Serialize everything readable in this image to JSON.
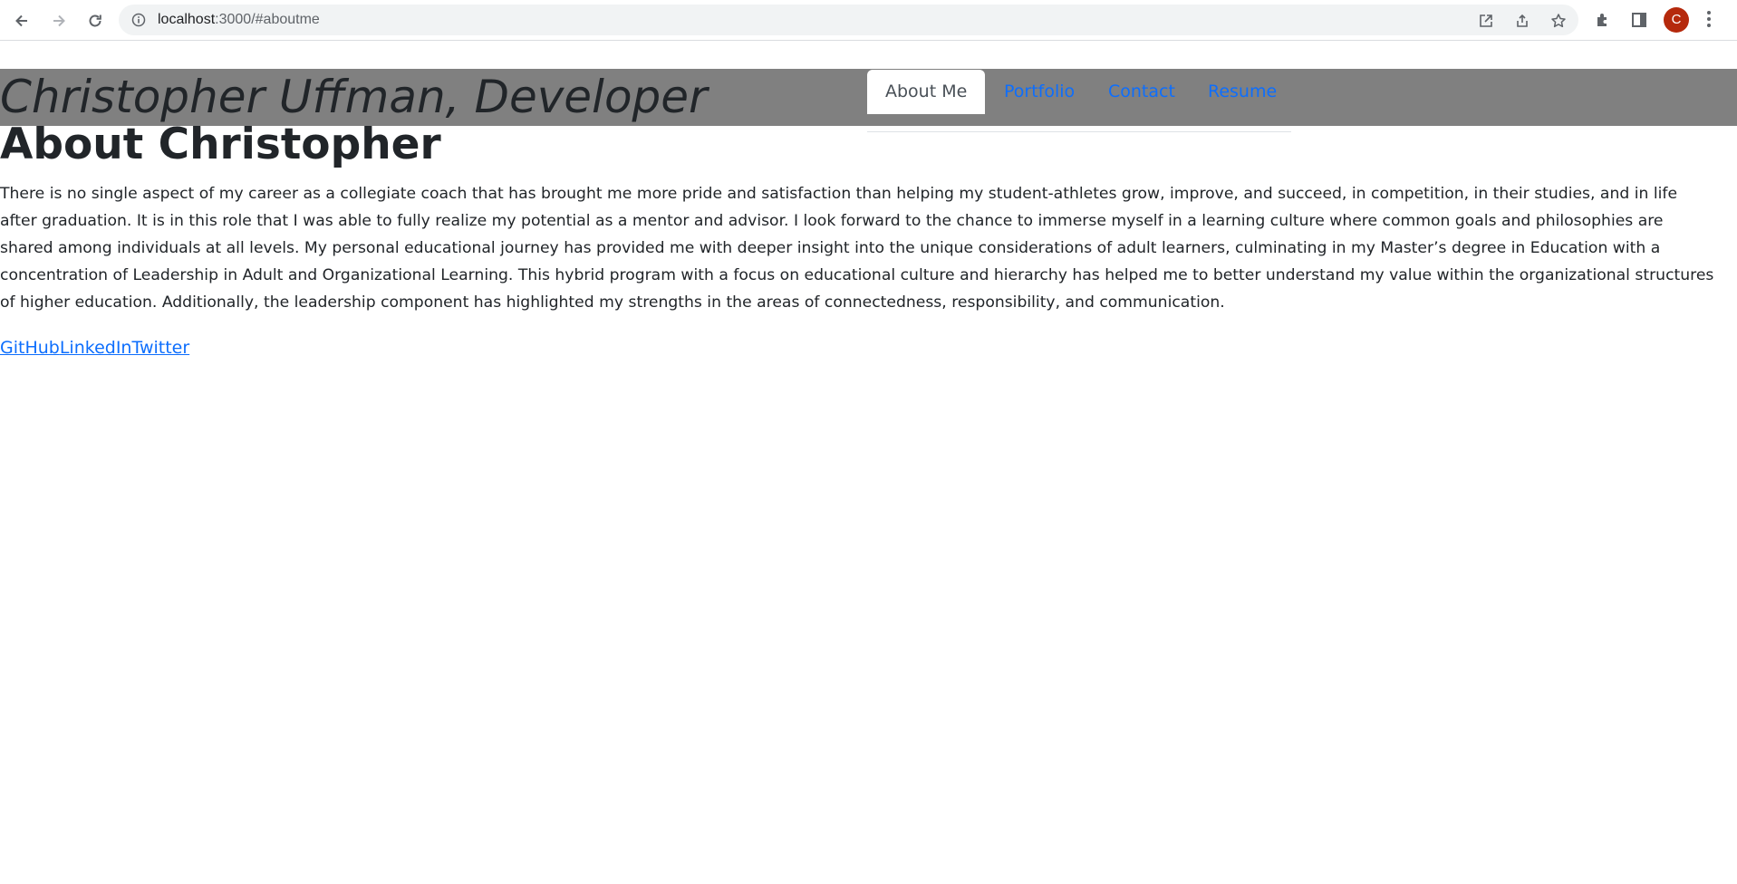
{
  "browser": {
    "url_host": "localhost",
    "url_path": ":3000/#aboutme",
    "profile_initial": "C"
  },
  "header": {
    "site_title": "Christopher Uffman, Developer",
    "tabs": [
      {
        "label": "About Me",
        "active": true
      },
      {
        "label": "Portfolio",
        "active": false
      },
      {
        "label": "Contact",
        "active": false
      },
      {
        "label": "Resume",
        "active": false
      }
    ]
  },
  "main": {
    "heading": "About Christopher",
    "bio": "There is no single aspect of my career as a collegiate coach that has brought me more pride and satisfaction than helping my student-athletes grow, improve, and succeed, in competition, in their studies, and in life after graduation. It is in this role that I was able to fully realize my potential as a mentor and advisor. I look forward to the chance to immerse myself in a learning culture where common goals and philosophies are shared among individuals at all levels. My personal educational journey has provided me with deeper insight into the unique considerations of adult learners, culminating in my Master’s degree in Education with a concentration of Leadership in Adult and Organizational Learning. This hybrid program with a focus on educational culture and hierarchy has helped me to better understand my value within the organizational structures of higher education. Additionally, the leadership component has highlighted my strengths in the areas of connectedness, responsibility, and communication.",
    "links": [
      "GitHub",
      "LinkedIn",
      "Twitter"
    ]
  },
  "colors": {
    "header_bg": "#808080",
    "link": "#0d6efd",
    "text": "#212529",
    "avatar": "#b5290c"
  },
  "icons": [
    "back-arrow-icon",
    "forward-arrow-icon",
    "reload-icon",
    "info-icon",
    "open-in-new-icon",
    "share-icon",
    "star-icon",
    "extensions-icon",
    "side-panel-icon",
    "menu-icon"
  ]
}
